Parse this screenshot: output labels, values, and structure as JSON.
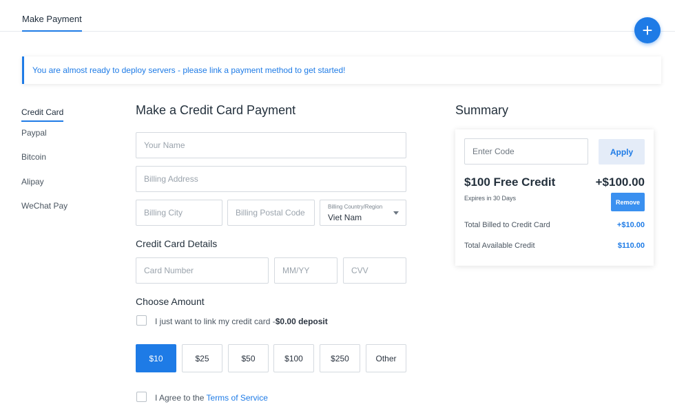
{
  "header": {
    "tab_label": "Make Payment",
    "add_icon": "plus-icon"
  },
  "notice": {
    "text": "You are almost ready to deploy servers - please link a payment method to get started!"
  },
  "sidebar": {
    "items": [
      {
        "label": "Credit Card",
        "active": true
      },
      {
        "label": "Paypal"
      },
      {
        "label": "Bitcoin"
      },
      {
        "label": "Alipay"
      },
      {
        "label": "WeChat Pay"
      }
    ]
  },
  "form": {
    "title": "Make a Credit Card Payment",
    "name_placeholder": "Your Name",
    "address_placeholder": "Billing Address",
    "city_placeholder": "Billing City",
    "postal_placeholder": "Billing Postal Code",
    "country_label": "Billing Country/Region",
    "country_value": "Viet Nam",
    "card_details_title": "Credit Card Details",
    "card_number_placeholder": "Card Number",
    "expiry_placeholder": "MM/YY",
    "cvv_placeholder": "CVV",
    "choose_amount_title": "Choose Amount",
    "link_only_prefix": "I just want to link my credit card -",
    "link_only_bold": "$0.00 deposit",
    "amounts": [
      "$10",
      "$25",
      "$50",
      "$100",
      "$250",
      "Other"
    ],
    "selected_amount": "$10",
    "agree_prefix": "I Agree to the ",
    "terms_link": "Terms of Service"
  },
  "summary": {
    "title": "Summary",
    "code_placeholder": "Enter Code",
    "apply_label": "Apply",
    "credit_title": "$100 Free Credit",
    "credit_amount": "+$100.00",
    "expires": "Expires in 30 Days",
    "remove_label": "Remove",
    "billed_label": "Total Billed to Credit Card",
    "billed_value": "+$10.00",
    "available_label": "Total Available Credit",
    "available_value": "$110.00"
  },
  "colors": {
    "accent": "#1e7be6",
    "apply_bg": "#e4ecf8",
    "remove_bg": "#3a90f0"
  }
}
